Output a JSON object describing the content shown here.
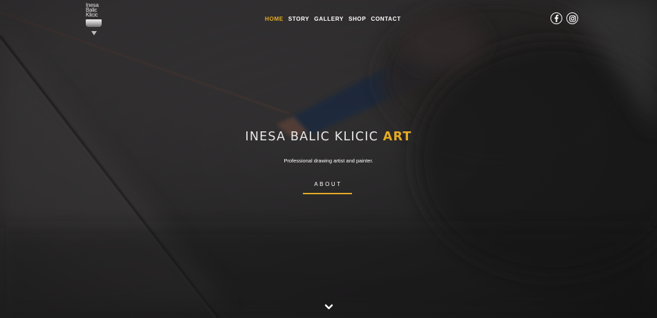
{
  "logo": {
    "lines": [
      "Inesa",
      "Balic",
      "Klicic"
    ]
  },
  "nav": {
    "items": [
      {
        "label": "HOME",
        "active": true
      },
      {
        "label": "STORY",
        "active": false
      },
      {
        "label": "GALLERY",
        "active": false
      },
      {
        "label": "SHOP",
        "active": false
      },
      {
        "label": "CONTACT",
        "active": false
      }
    ]
  },
  "social": {
    "icons": [
      "facebook-icon",
      "instagram-icon"
    ]
  },
  "hero": {
    "title_main": "INESA BALIC KLICIC",
    "title_accent": "ART",
    "tagline": "Professional drawing artist and painter.",
    "cta_label": "ABOUT"
  },
  "scroll": {
    "icon": "chevron-down-icon"
  },
  "colors": {
    "accent": "#e3ac24",
    "text": "#ffffff",
    "background": "#242424"
  }
}
